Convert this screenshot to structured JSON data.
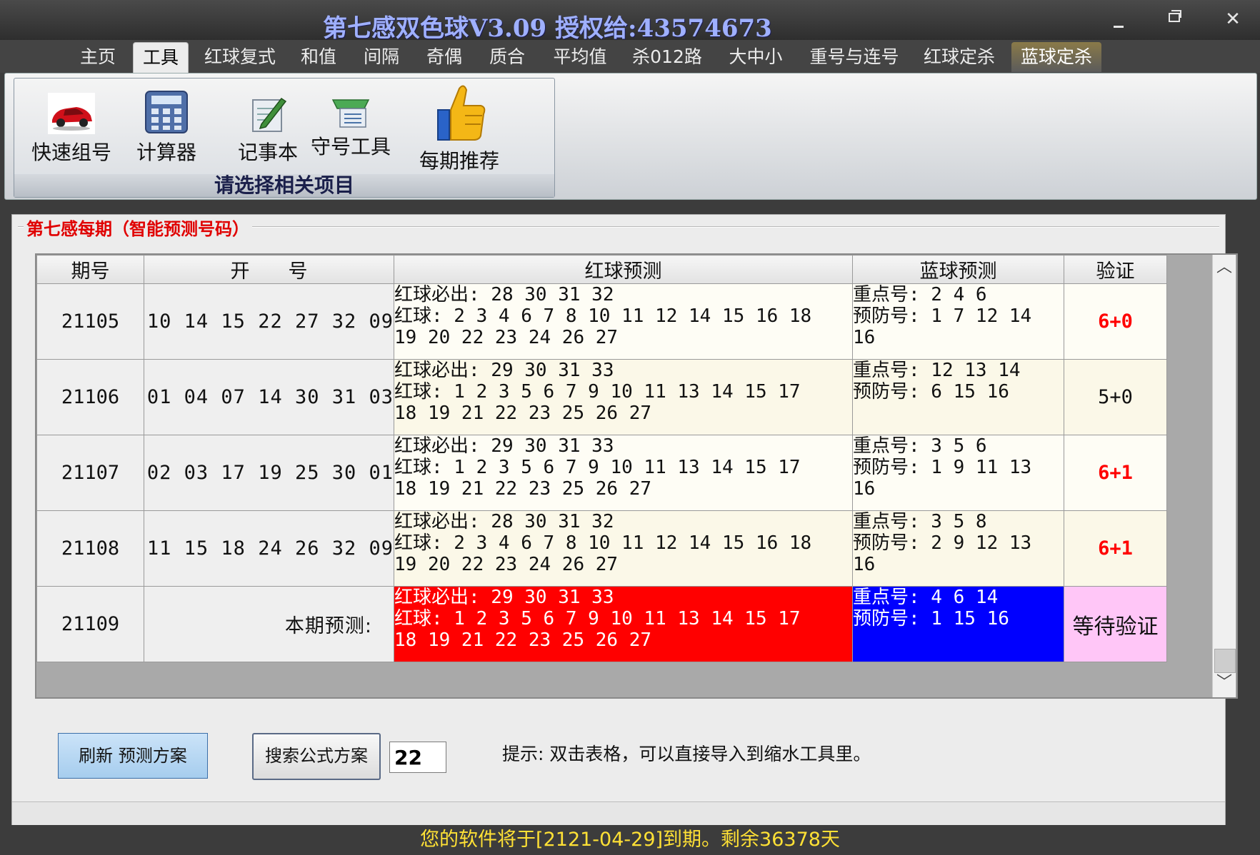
{
  "window": {
    "title": "第七感双色球V3.09  授权给:43574673"
  },
  "tabs": [
    {
      "label": "主页"
    },
    {
      "label": "工具"
    },
    {
      "label": "红球复式"
    },
    {
      "label": "和值"
    },
    {
      "label": "间隔"
    },
    {
      "label": "奇偶"
    },
    {
      "label": "质合"
    },
    {
      "label": "平均值"
    },
    {
      "label": "杀012路"
    },
    {
      "label": "大中小"
    },
    {
      "label": "重号与连号"
    },
    {
      "label": "红球定杀"
    },
    {
      "label": "蓝球定杀"
    }
  ],
  "active_tab": "工具",
  "ribbon": {
    "items": [
      {
        "label": "快速组号",
        "icon": "red-car-icon"
      },
      {
        "label": "计算器",
        "icon": "calculator-icon"
      },
      {
        "label": "记事本",
        "icon": "notepad-icon"
      },
      {
        "label": "守号工具",
        "icon": "document-stack-icon"
      },
      {
        "label": "每期推荐",
        "icon": "thumbs-up-icon"
      }
    ],
    "caption": "请选择相关项目"
  },
  "panel": {
    "legend": "第七感每期（智能预测号码）"
  },
  "grid": {
    "headers": [
      "期号",
      "开　　号",
      "红球预测",
      "蓝球预测",
      "验证"
    ],
    "rows": [
      {
        "period": "21105",
        "draw": "10 14 15 22 27 32 09",
        "red_lines": [
          "红球必出: 28 30 31 32",
          "红球: 2 3 4 6 7 8 10 11 12 14 15 16 18",
          "19 20 22 23 24 26 27"
        ],
        "blue_lines": [
          "重点号: 2 4 6",
          "预防号: 1 7 12 14",
          "16"
        ],
        "verify": "6+0",
        "verify_color": "#ff0000"
      },
      {
        "period": "21106",
        "draw": "01 04 07 14 30 31 03",
        "red_lines": [
          "红球必出: 29 30 31 33",
          "红球: 1 2 3 5 6 7 9 10 11 13 14 15 17",
          "18 19 21 22 23 25 26 27"
        ],
        "blue_lines": [
          "重点号: 12 13 14",
          "预防号: 6 15 16"
        ],
        "verify": "5+0",
        "verify_color": "#111111"
      },
      {
        "period": "21107",
        "draw": "02 03 17 19 25 30 01",
        "red_lines": [
          "红球必出: 29 30 31 33",
          "红球: 1 2 3 5 6 7 9 10 11 13 14 15 17",
          "18 19 21 22 23 25 26 27"
        ],
        "blue_lines": [
          "重点号: 3 5 6",
          "预防号: 1 9 11 13",
          "16"
        ],
        "verify": "6+1",
        "verify_color": "#ff0000"
      },
      {
        "period": "21108",
        "draw": "11 15 18 24 26 32 09",
        "red_lines": [
          "红球必出: 28 30 31 32",
          "红球: 2 3 4 6 7 8 10 11 12 14 15 16 18",
          "19 20 22 23 24 26 27"
        ],
        "blue_lines": [
          "重点号: 3 5 8",
          "预防号: 2 9 12 13",
          "16"
        ],
        "verify": "6+1",
        "verify_color": "#ff0000"
      }
    ],
    "current": {
      "period": "21109",
      "label": "本期预测:",
      "red_lines": [
        "红球必出: 29 30 31 33",
        "红球: 1 2 3 5 6 7 9 10 11 13 14 15 17",
        "18 19 21 22 23 25 26 27"
      ],
      "blue_lines": [
        "重点号: 4 6 14",
        "预防号: 1 15 16"
      ],
      "verify": "等待验证"
    }
  },
  "controls": {
    "refresh_label": "刷新 预测方案",
    "search_label": "搜索公式方案",
    "input_value": "22",
    "hint": "提示: 双击表格，可以直接导入到缩水工具里。"
  },
  "status": {
    "footer": "您的软件将于[2121-04-29]到期。剩余36378天"
  },
  "colors": {
    "current_red_bg": "#ff0000",
    "current_blue_bg": "#0000ff",
    "wait_bg": "#ffc6f7",
    "footer_text": "#ffe135",
    "legend_text": "#e00000"
  }
}
